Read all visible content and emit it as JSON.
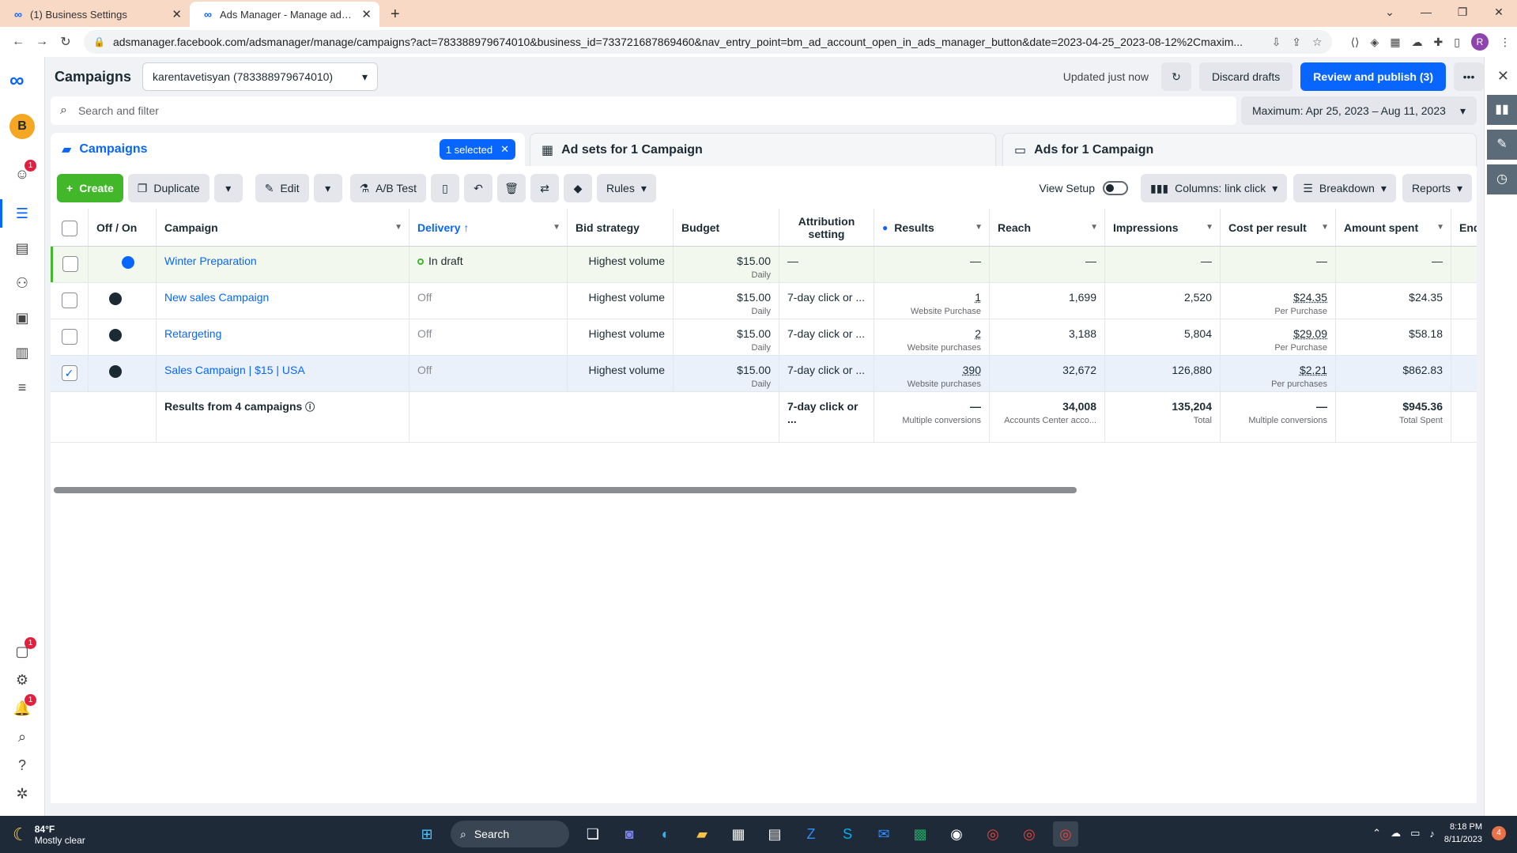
{
  "browser": {
    "tabs": [
      {
        "title": "(1) Business Settings",
        "active": false
      },
      {
        "title": "Ads Manager - Manage ads - Ca",
        "active": true
      }
    ],
    "url": "adsmanager.facebook.com/adsmanager/manage/campaigns?act=783388979674010&business_id=733721687869460&nav_entry_point=bm_ad_account_open_in_ads_manager_button&date=2023-04-25_2023-08-12%2Cmaxim...",
    "profile_initial": "R"
  },
  "nav": {
    "avatar": "B",
    "badges": {
      "alerts": "1",
      "bottom_pages": "1",
      "notifications": "1"
    }
  },
  "header": {
    "title": "Campaigns",
    "account": "karentavetisyan (783388979674010)",
    "updated": "Updated just now",
    "discard": "Discard drafts",
    "publish": "Review and publish (3)"
  },
  "search": {
    "placeholder": "Search and filter",
    "date_range": "Maximum: Apr 25, 2023 – Aug 11, 2023"
  },
  "tabs": {
    "campaigns": "Campaigns",
    "selected": "1 selected",
    "adsets": "Ad sets for 1 Campaign",
    "ads": "Ads for 1 Campaign"
  },
  "toolbar": {
    "create": "Create",
    "duplicate": "Duplicate",
    "edit": "Edit",
    "abtest": "A/B Test",
    "rules": "Rules",
    "view_setup": "View Setup",
    "columns": "Columns: link click",
    "breakdown": "Breakdown",
    "reports": "Reports"
  },
  "table": {
    "headers": {
      "offon": "Off / On",
      "campaign": "Campaign",
      "delivery": "Delivery ↑",
      "bid": "Bid strategy",
      "budget": "Budget",
      "attribution": "Attribution setting",
      "results": "Results",
      "reach": "Reach",
      "impressions": "Impressions",
      "cpr": "Cost per result",
      "spent": "Amount spent",
      "ends": "End"
    },
    "rows": [
      {
        "name": "Winter Preparation",
        "delivery": "In draft",
        "bid": "Highest volume",
        "budget": "$15.00",
        "budget_sub": "Daily",
        "attribution": "—",
        "results": "—",
        "results_sub": "",
        "reach": "—",
        "impressions": "—",
        "cpr": "—",
        "cpr_sub": "",
        "spent": "—"
      },
      {
        "name": "New sales Campaign",
        "delivery": "Off",
        "bid": "Highest volume",
        "budget": "$15.00",
        "budget_sub": "Daily",
        "attribution": "7-day click or ...",
        "results": "1",
        "results_sub": "Website Purchase",
        "reach": "1,699",
        "impressions": "2,520",
        "cpr": "$24.35",
        "cpr_sub": "Per Purchase",
        "spent": "$24.35"
      },
      {
        "name": "Retargeting",
        "delivery": "Off",
        "bid": "Highest volume",
        "budget": "$15.00",
        "budget_sub": "Daily",
        "attribution": "7-day click or ...",
        "results": "2",
        "results_sub": "Website purchases",
        "reach": "3,188",
        "impressions": "5,804",
        "cpr": "$29.09",
        "cpr_sub": "Per Purchase",
        "spent": "$58.18"
      },
      {
        "name": "Sales Campaign | $15 | USA",
        "delivery": "Off",
        "bid": "Highest volume",
        "budget": "$15.00",
        "budget_sub": "Daily",
        "attribution": "7-day click or ...",
        "results": "390",
        "results_sub": "Website purchases",
        "reach": "32,672",
        "impressions": "126,880",
        "cpr": "$2.21",
        "cpr_sub": "Per purchases",
        "spent": "$862.83"
      }
    ],
    "totals": {
      "label": "Results from 4 campaigns",
      "attribution": "7-day click or ...",
      "results": "—",
      "results_sub": "Multiple conversions",
      "reach": "34,008",
      "reach_sub": "Accounts Center acco...",
      "impressions": "135,204",
      "impressions_sub": "Total",
      "cpr": "—",
      "cpr_sub": "Multiple conversions",
      "spent": "$945.36",
      "spent_sub": "Total Spent"
    }
  },
  "taskbar": {
    "temp": "84°F",
    "weather": "Mostly clear",
    "search": "Search",
    "time": "8:18 PM",
    "date": "8/11/2023",
    "notifications": "4"
  }
}
